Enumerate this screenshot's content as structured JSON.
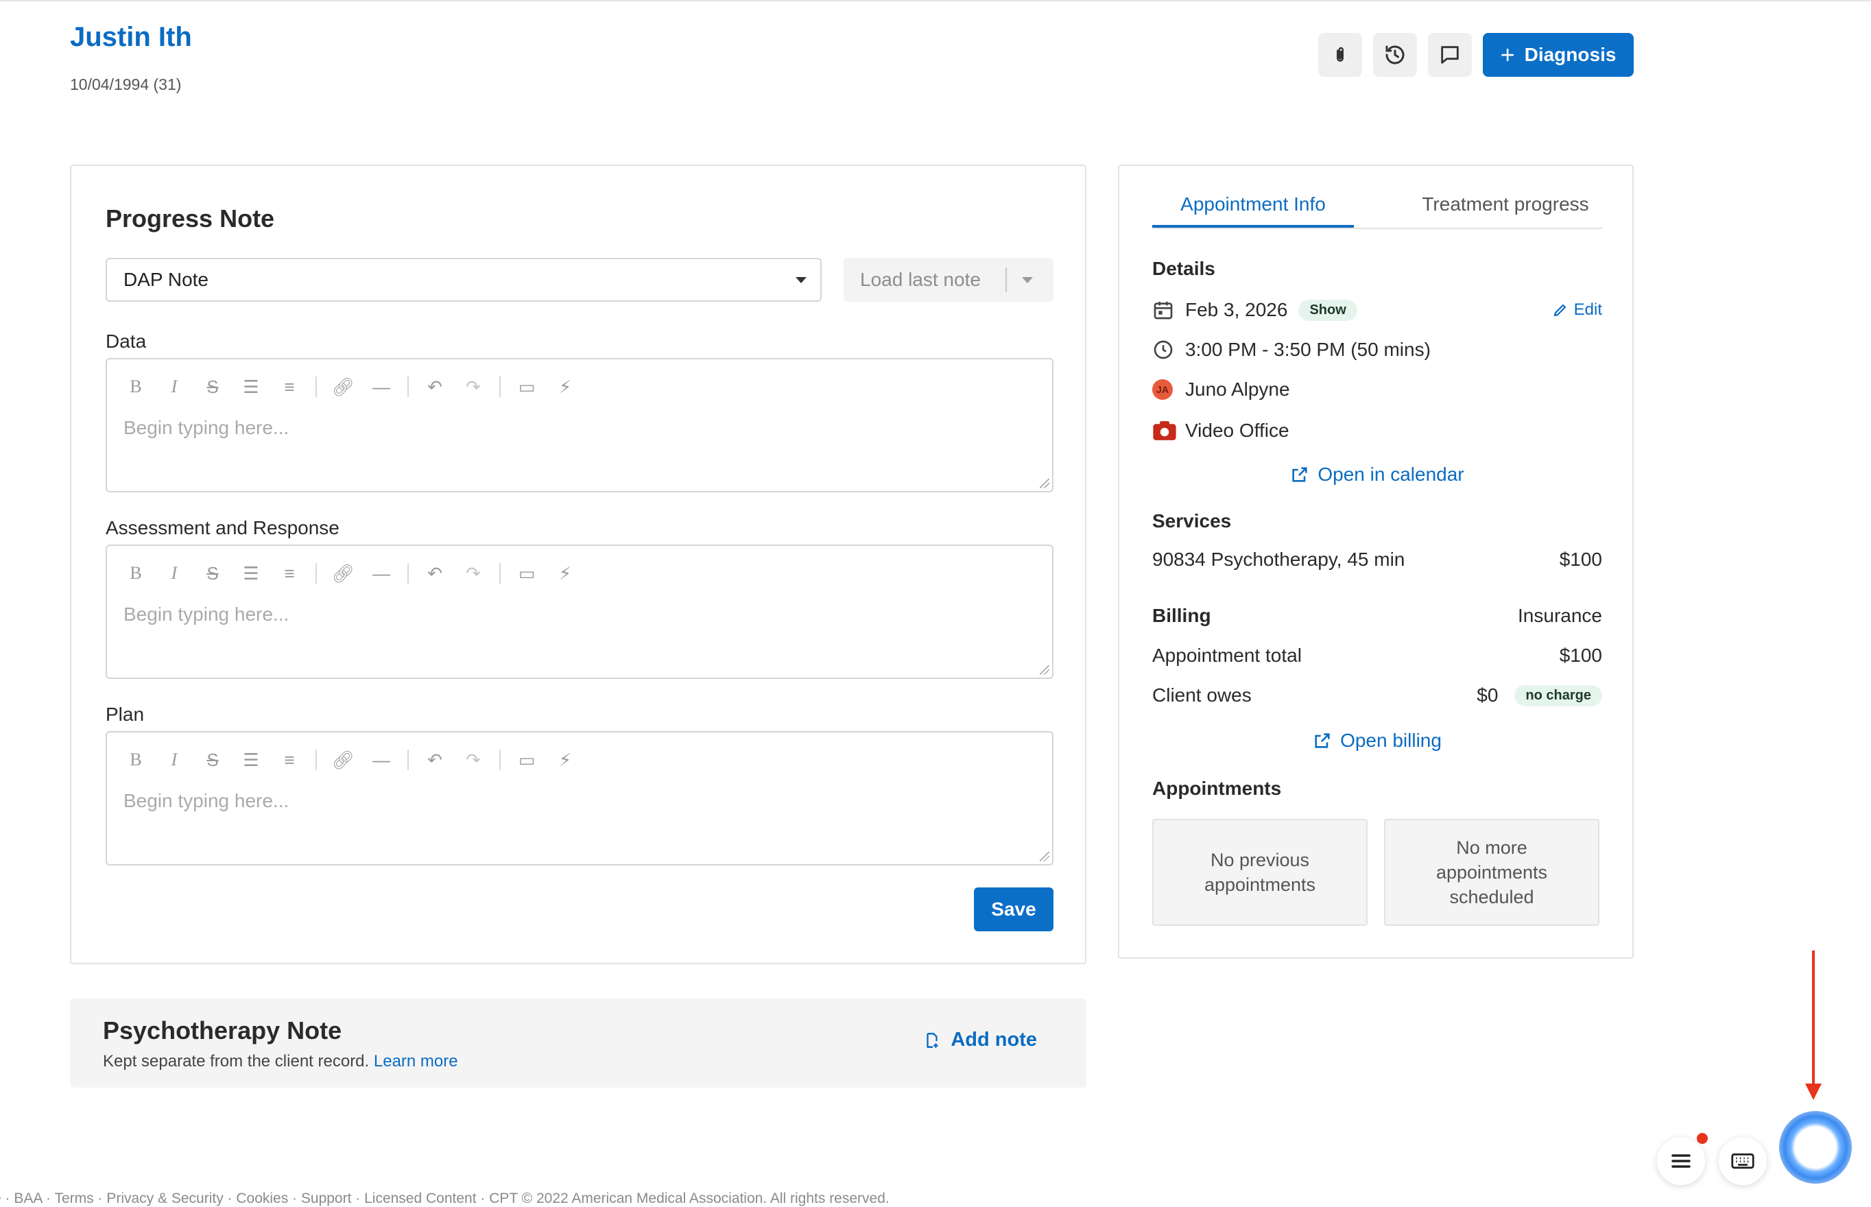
{
  "client": {
    "name": "Justin Ith",
    "dob": "10/04/1994 (31)"
  },
  "header": {
    "icons": [
      "paperclip-icon",
      "history-icon",
      "comment-icon"
    ],
    "diagnosis_label": "Diagnosis"
  },
  "progress_note": {
    "title": "Progress Note",
    "template_value": "DAP Note",
    "load_last_label": "Load last note",
    "fields": [
      {
        "label": "Data",
        "placeholder": "Begin typing here..."
      },
      {
        "label": "Assessment and Response",
        "placeholder": "Begin typing here..."
      },
      {
        "label": "Plan",
        "placeholder": "Begin typing here..."
      }
    ],
    "save_label": "Save"
  },
  "psychotherapy": {
    "title": "Psychotherapy Note",
    "subtitle": "Kept separate from the client record.",
    "learn_more": "Learn more",
    "add_note": "Add note"
  },
  "appointment": {
    "tabs": [
      "Appointment Info",
      "Treatment progress"
    ],
    "details_title": "Details",
    "date": "Feb 3, 2026",
    "status_badge": "Show",
    "edit_label": "Edit",
    "time": "3:00 PM - 3:50 PM (50 mins)",
    "clinician_initials": "JA",
    "clinician": "Juno Alpyne",
    "location": "Video Office",
    "open_calendar": "Open in calendar",
    "services_title": "Services",
    "service_name": "90834 Psychotherapy, 45 min",
    "service_price": "$100",
    "billing_title": "Billing",
    "billing_type": "Insurance",
    "total_label": "Appointment total",
    "total_value": "$100",
    "owes_label": "Client owes",
    "owes_value": "$0",
    "owes_badge": "no charge",
    "open_billing": "Open billing",
    "appointments_title": "Appointments",
    "prev_appts": "No previous appointments",
    "next_appts": "No more appointments scheduled"
  },
  "footer": {
    "text": "e · BAA · Terms · Privacy & Security · Cookies · Support · Licensed Content · CPT © 2022 American Medical Association. All rights reserved."
  },
  "colors": {
    "accent": "#0b6fc8",
    "link": "#0a6cc2",
    "annotation_arrow": "#e8341c"
  }
}
